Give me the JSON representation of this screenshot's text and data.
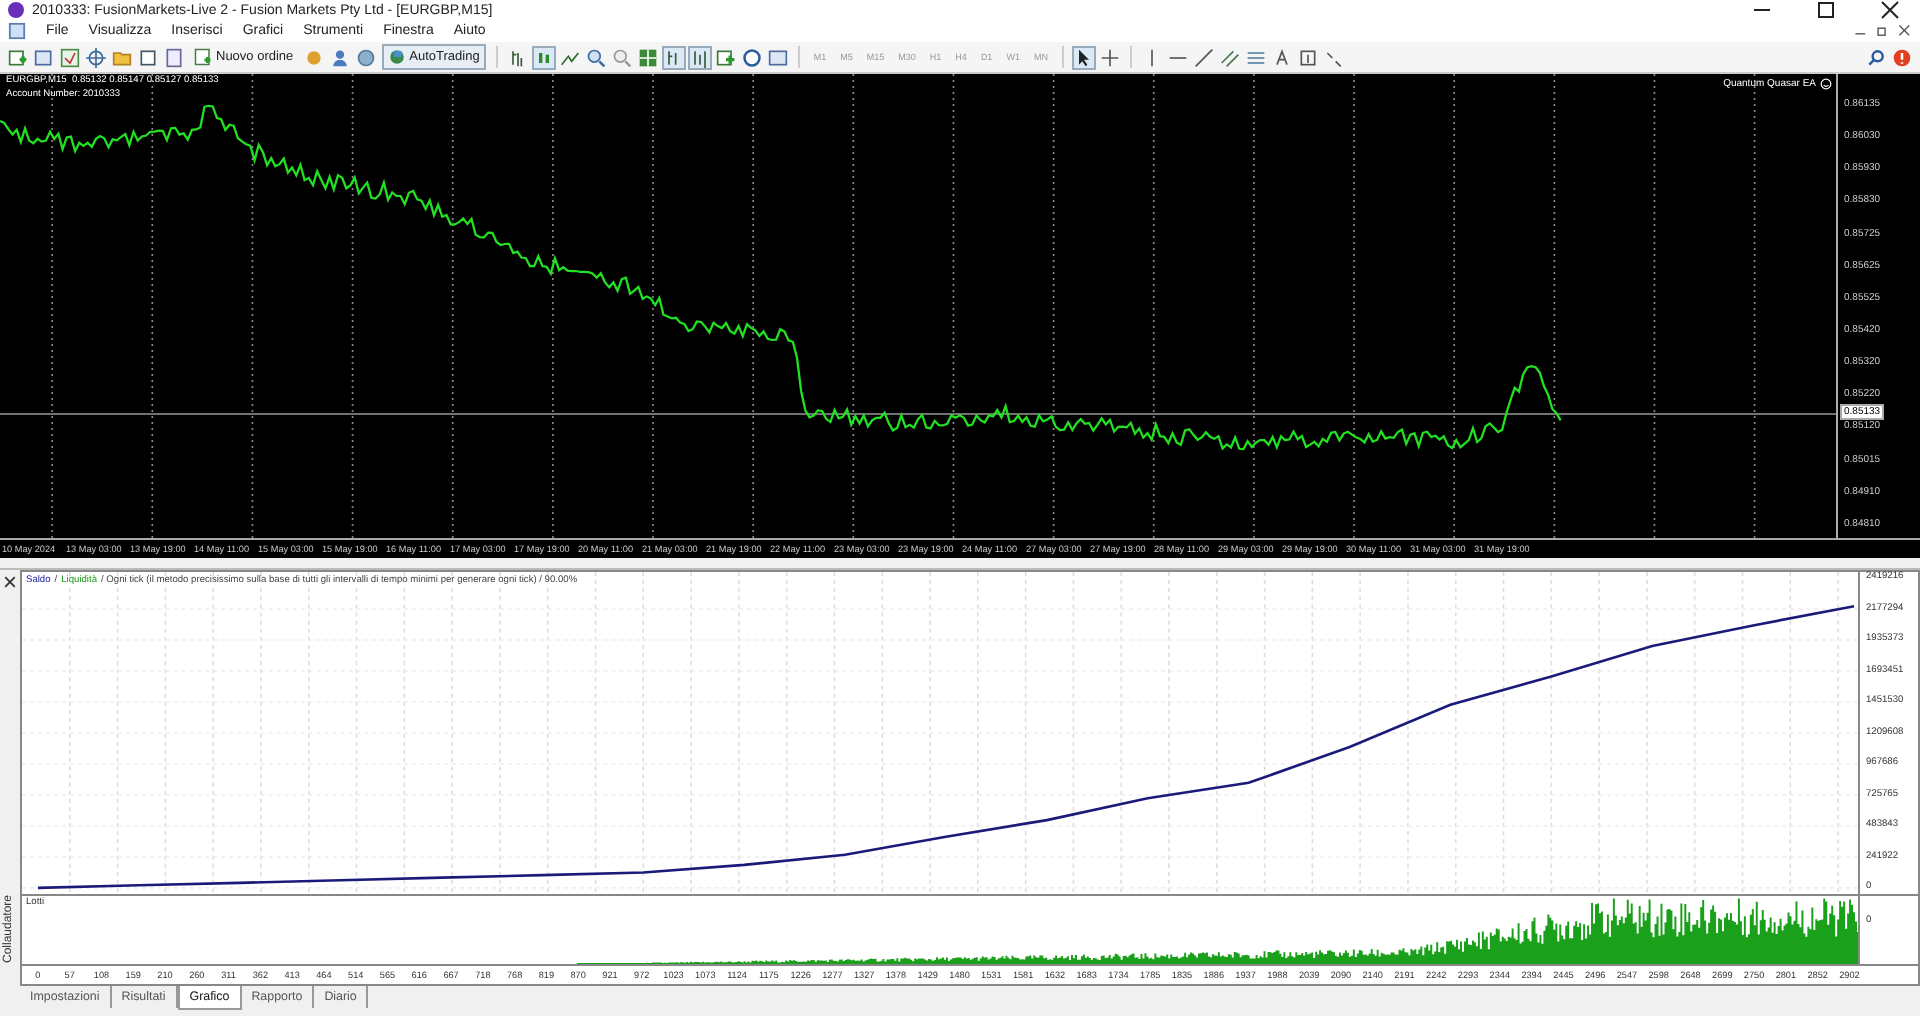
{
  "window": {
    "title": "2010333: FusionMarkets-Live 2 - Fusion Markets Pty Ltd - [EURGBP,M15]"
  },
  "menu": [
    "File",
    "Visualizza",
    "Inserisci",
    "Grafici",
    "Strumenti",
    "Finestra",
    "Aiuto"
  ],
  "toolbar": {
    "new_order": "Nuovo ordine",
    "autotrading": "AutoTrading",
    "timeframes": [
      "M1",
      "M5",
      "M15",
      "M30",
      "H1",
      "H4",
      "D1",
      "W1",
      "MN"
    ]
  },
  "chart": {
    "header": "EURGBP,M15  0.85132 0.85147 0.85127 0.85133",
    "account": "Account Number: 2010333",
    "expert": "Quantum Quasar EA",
    "price_labels": [
      "0.86135",
      "0.86030",
      "0.85930",
      "0.85830",
      "0.85725",
      "0.85625",
      "0.85525",
      "0.85420",
      "0.85320",
      "0.85220",
      "0.85120",
      "0.85015",
      "0.84910",
      "0.84810"
    ],
    "current_price": "0.85133",
    "time_labels": [
      "10 May 2024",
      "13 May 03:00",
      "13 May 19:00",
      "14 May 11:00",
      "15 May 03:00",
      "15 May 19:00",
      "16 May 11:00",
      "17 May 03:00",
      "17 May 19:00",
      "20 May 11:00",
      "21 May 03:00",
      "21 May 19:00",
      "22 May 11:00",
      "23 May 03:00",
      "23 May 19:00",
      "24 May 11:00",
      "27 May 03:00",
      "27 May 19:00",
      "28 May 11:00",
      "29 May 03:00",
      "29 May 19:00",
      "30 May 11:00",
      "31 May 03:00",
      "31 May 19:00"
    ]
  },
  "tester": {
    "legend_equity": "Liquidità",
    "legend_text": " / Ogni tick (il metodo precisissimo sulla base di tutti gli intervalli di tempo minimi per generare ogni tick) / 90.00%",
    "legend_separator": "/",
    "chart_data": {
      "type": "line",
      "grid": true,
      "series": [
        {
          "name": "Saldo",
          "color": "#1a1a7a",
          "values": [
            0,
            20000,
            40000,
            60000,
            80000,
            100000,
            120000,
            180000,
            260000,
            400000,
            530000,
            700000,
            820000,
            1100000,
            1430000,
            1650000,
            1890000,
            2050000,
            2200000
          ]
        }
      ],
      "ylim": [
        0,
        2466651
      ],
      "yticks": [
        2419216,
        2177294,
        1935373,
        1693451,
        1451530,
        1209608,
        967686,
        725765,
        483843,
        241922,
        0
      ]
    },
    "lots_title": "Lotti",
    "lots_zero": "0",
    "x_labels": [
      "0",
      "57",
      "108",
      "159",
      "210",
      "260",
      "311",
      "362",
      "413",
      "464",
      "514",
      "565",
      "616",
      "667",
      "718",
      "768",
      "819",
      "870",
      "921",
      "972",
      "1023",
      "1073",
      "1124",
      "1175",
      "1226",
      "1277",
      "1327",
      "1378",
      "1429",
      "1480",
      "1531",
      "1581",
      "1632",
      "1683",
      "1734",
      "1785",
      "1835",
      "1886",
      "1937",
      "1988",
      "2039",
      "2090",
      "2140",
      "2191",
      "2242",
      "2293",
      "2344",
      "2394",
      "2445",
      "2496",
      "2547",
      "2598",
      "2648",
      "2699",
      "2750",
      "2801",
      "2852",
      "2902"
    ],
    "side_label": "Collaudatore",
    "tabs": [
      {
        "label": "Impostazioni",
        "selected": false
      },
      {
        "label": "Risultati",
        "selected": false
      },
      {
        "label": "Grafico",
        "selected": true
      },
      {
        "label": "Rapporto",
        "selected": false
      },
      {
        "label": "Diario",
        "selected": false
      }
    ]
  }
}
